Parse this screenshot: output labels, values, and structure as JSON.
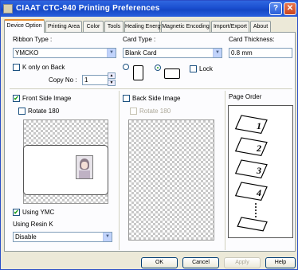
{
  "window": {
    "title": "CIAAT CTC-940 Printing Preferences",
    "help_glyph": "?",
    "close_glyph": "✕"
  },
  "tabs": [
    "Device Option",
    "Printing Area",
    "Color",
    "Tools",
    "Healing Energy",
    "Magnetic Encoding",
    "Import/Export",
    "About"
  ],
  "ribbon": {
    "label": "Ribbon Type :",
    "value": "YMCKO",
    "konly_label": "K only on Back",
    "copy_label": "Copy No :",
    "copy_value": "1"
  },
  "card": {
    "label": "Card Type :",
    "value": "Blank Card",
    "lock_label": "Lock",
    "thickness_label": "Card Thickness:",
    "thickness_value": "0.8 mm"
  },
  "front": {
    "label": "Front Side Image",
    "checked": true,
    "rotate_label": "Rotate 180",
    "using_ymc_label": "Using YMC",
    "using_ymc_checked": true,
    "resin_label": "Using Resin K",
    "resin_value": "Disable"
  },
  "back": {
    "label": "Back Side Image",
    "checked": false,
    "rotate_label": "Rotate 180"
  },
  "page_order": {
    "label": "Page Order",
    "pages": [
      "1",
      "2",
      "3",
      "4"
    ]
  },
  "buttons": {
    "ok": "OK",
    "cancel": "Cancel",
    "apply": "Apply",
    "help": "Help"
  },
  "colors": {
    "title_bar": "#1a4fd0",
    "tab_accent": "#e68b2c",
    "check": "#21a121"
  }
}
